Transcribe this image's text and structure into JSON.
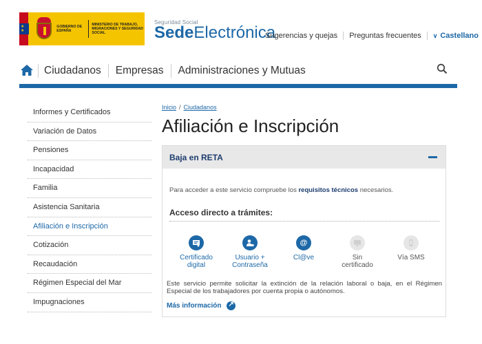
{
  "header": {
    "logo": {
      "left_text": "GOBIERNO DE ESPAÑA",
      "right_text": "MINISTERIO DE TRABAJO, MIGRACIONES Y SEGURIDAD SOCIAL",
      "colors": {
        "background": "#f5c400",
        "flag_red": "#c60b1e"
      }
    },
    "sede_small": "Seguridad Social",
    "sede_bold": "Sede",
    "sede_light": "Electrónica",
    "links": [
      "Sugerencias y quejas",
      "Preguntas frecuentes"
    ],
    "language": "Castellano"
  },
  "nav": {
    "home_icon": "home-icon",
    "items": [
      "Ciudadanos",
      "Empresas",
      "Administraciones y Mutuas"
    ],
    "search_icon": "search-icon",
    "accent": "#1d68a7"
  },
  "sidebar": {
    "items": [
      {
        "label": "Informes y Certificados"
      },
      {
        "label": "Variación de Datos"
      },
      {
        "label": "Pensiones"
      },
      {
        "label": "Incapacidad"
      },
      {
        "label": "Familia"
      },
      {
        "label": "Asistencia Sanitaria"
      },
      {
        "label": "Afiliación e Inscripción",
        "active": true
      },
      {
        "label": "Cotización"
      },
      {
        "label": "Recaudación"
      },
      {
        "label": "Régimen Especial del Mar"
      },
      {
        "label": "Impugnaciones"
      }
    ]
  },
  "main": {
    "breadcrumb": [
      "Inicio",
      "Ciudadanos"
    ],
    "breadcrumb_sep": "/",
    "title": "Afiliación e Inscripción",
    "panel": {
      "title": "Baja en RETA",
      "req_pre": "Para acceder a este servicio compruebe los ",
      "req_link": "requisitos técnicos",
      "req_post": " necesarios.",
      "access_title": "Acceso directo a trámites:",
      "tramites": [
        {
          "label1": "Certificado",
          "label2": "digital",
          "icon": "certificate-icon",
          "enabled": true
        },
        {
          "label1": "Usuario +",
          "label2": "Contraseña",
          "icon": "user-lock-icon",
          "enabled": true
        },
        {
          "label1": "Cl@ve",
          "label2": "",
          "icon": "at-icon",
          "enabled": true
        },
        {
          "label1": "Sin",
          "label2": "certificado",
          "icon": "computer-icon",
          "enabled": false
        },
        {
          "label1": "Vía SMS",
          "label2": "",
          "icon": "phone-icon",
          "enabled": false
        }
      ],
      "description": "Este servicio permite solicitar la extinción de la relación laboral o baja, en el Régimen Especial de los trabajadores por cuenta propia o autónomos.",
      "more_info": "Más información"
    }
  }
}
